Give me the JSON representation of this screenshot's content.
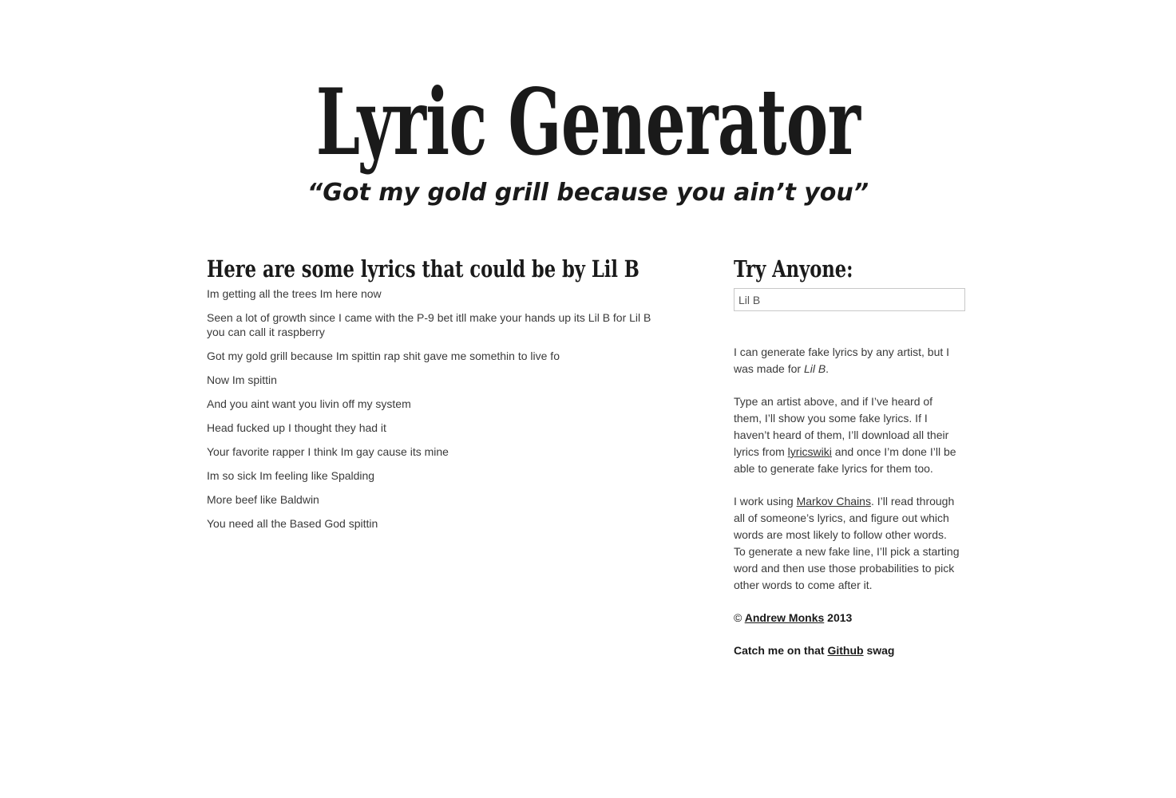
{
  "header": {
    "title": "Lyric Generator",
    "tagline": "“Got my gold grill because you ain’t you”"
  },
  "lyrics": {
    "heading": "Here are some lyrics that could be by Lil B",
    "lines": [
      "Im getting all the trees Im here now",
      "Seen a lot of growth since I came with the P-9 bet itll make your hands up its Lil B for Lil B you can call it raspberry",
      "Got my gold grill because Im spittin rap shit gave me somethin to live fo",
      "Now Im spittin",
      "And you aint want you livin off my system",
      "Head fucked up I thought they had it",
      "Your favorite rapper I think Im gay cause its mine",
      "Im so sick Im feeling like Spalding",
      "More beef like Baldwin",
      "You need all the Based God spittin"
    ]
  },
  "sidebar": {
    "heading": "Try Anyone:",
    "input_value": "Lil B",
    "about_text": "I can generate fake lyrics by any artist, but I was made for ",
    "about_artist": "Lil B",
    "about_end": ".",
    "instructions_before": "Type an artist above, and if I’ve heard of them, I’ll show you some fake lyrics. If I haven’t heard of them, I’ll download all their lyrics from ",
    "lyricswiki_link": "lyricswiki",
    "instructions_after": " and once I’m done I’ll be able to generate fake lyrics for them too.",
    "how_before": "I work using ",
    "markov_link": "Markov Chains",
    "how_after": ". I’ll read through all of someone’s lyrics, and figure out which words are most likely to follow other words. To generate a new fake line, I’ll pick a starting word and then use those probabilities to pick other words to come after it.",
    "copyright_symbol": "©",
    "author_link": "Andrew Monks",
    "year": "2013",
    "github_before": "Catch me on that ",
    "github_link": "Github",
    "github_after": " swag"
  }
}
